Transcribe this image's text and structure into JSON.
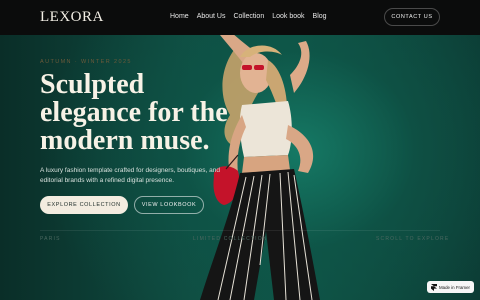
{
  "brand": {
    "logo": "LEXORA"
  },
  "nav": {
    "items": [
      {
        "label": "Home"
      },
      {
        "label": "About Us"
      },
      {
        "label": "Collection"
      },
      {
        "label": "Look book"
      },
      {
        "label": "Blog"
      }
    ],
    "cta_label": "CONTACT US"
  },
  "hero": {
    "eyebrow": "AUTUMN · WINTER 2025",
    "title": "Sculpted elegance for the modern muse.",
    "description": "A luxury fashion template crafted for designers, boutiques, and editorial brands with a refined digital presence.",
    "primary_button": "EXPLORE COLLECTION",
    "secondary_button": "VIEW LOOKBOOK"
  },
  "footer_strip": {
    "left": "PARIS",
    "center": "LIMITED COLLECTION",
    "right": "SCROLL TO EXPLORE"
  },
  "badge": {
    "label": "Made in Framer"
  },
  "colors": {
    "nav_bg": "#0b0c0c",
    "hero_bg": "#0f4c41",
    "cream": "#f3ece0",
    "accent_red": "#c4132a"
  }
}
